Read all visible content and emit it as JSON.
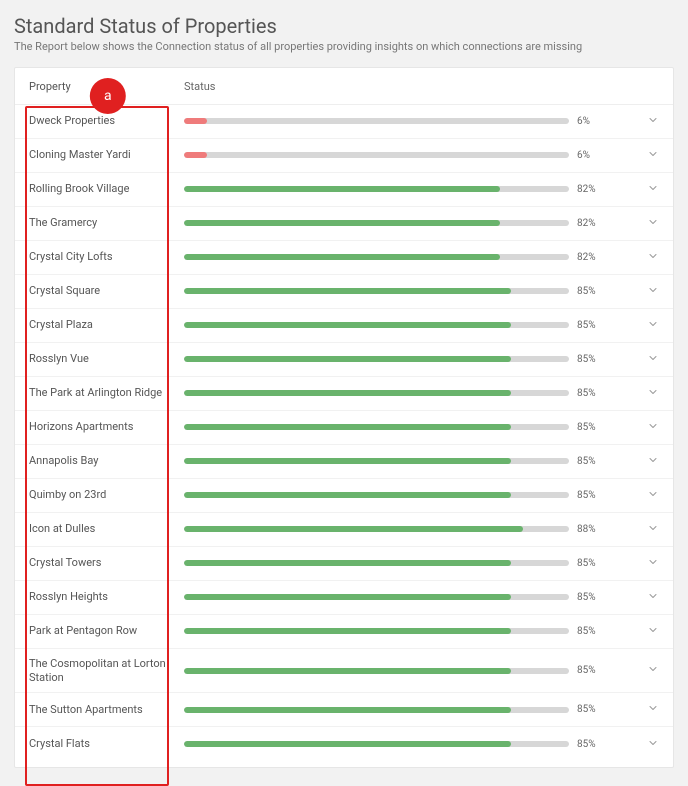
{
  "page": {
    "title": "Standard Status of Properties",
    "subtitle": "The Report below shows the Connection status of all properties providing insights on which connections are missing"
  },
  "table": {
    "headers": {
      "property": "Property",
      "status": "Status"
    }
  },
  "colors": {
    "low": "#ef7b7b",
    "ok": "#69b36c",
    "track": "#d7d7d7"
  },
  "rows": [
    {
      "name": "Dweck Properties",
      "pct": 6,
      "level": "low"
    },
    {
      "name": "Cloning Master Yardi",
      "pct": 6,
      "level": "low"
    },
    {
      "name": "Rolling Brook Village",
      "pct": 82,
      "level": "ok"
    },
    {
      "name": "The Gramercy",
      "pct": 82,
      "level": "ok"
    },
    {
      "name": "Crystal City Lofts",
      "pct": 82,
      "level": "ok"
    },
    {
      "name": "Crystal Square",
      "pct": 85,
      "level": "ok"
    },
    {
      "name": "Crystal Plaza",
      "pct": 85,
      "level": "ok"
    },
    {
      "name": "Rosslyn Vue",
      "pct": 85,
      "level": "ok"
    },
    {
      "name": "The Park at Arlington Ridge",
      "pct": 85,
      "level": "ok"
    },
    {
      "name": "Horizons Apartments",
      "pct": 85,
      "level": "ok"
    },
    {
      "name": "Annapolis Bay",
      "pct": 85,
      "level": "ok"
    },
    {
      "name": "Quimby on 23rd",
      "pct": 85,
      "level": "ok"
    },
    {
      "name": "Icon at Dulles",
      "pct": 88,
      "level": "ok"
    },
    {
      "name": "Crystal Towers",
      "pct": 85,
      "level": "ok"
    },
    {
      "name": "Rosslyn Heights",
      "pct": 85,
      "level": "ok"
    },
    {
      "name": "Park at Pentagon Row",
      "pct": 85,
      "level": "ok"
    },
    {
      "name": "The Cosmopolitan at Lorton Station",
      "pct": 85,
      "level": "ok"
    },
    {
      "name": "The Sutton Apartments",
      "pct": 85,
      "level": "ok"
    },
    {
      "name": "Crystal Flats",
      "pct": 85,
      "level": "ok"
    }
  ],
  "annotation": {
    "label": "a"
  },
  "chart_data": {
    "type": "bar",
    "title": "Standard Status of Properties",
    "xlabel": "Status (%)",
    "ylabel": "Property",
    "xlim": [
      0,
      100
    ],
    "categories": [
      "Dweck Properties",
      "Cloning Master Yardi",
      "Rolling Brook Village",
      "The Gramercy",
      "Crystal City Lofts",
      "Crystal Square",
      "Crystal Plaza",
      "Rosslyn Vue",
      "The Park at Arlington Ridge",
      "Horizons Apartments",
      "Annapolis Bay",
      "Quimby on 23rd",
      "Icon at Dulles",
      "Crystal Towers",
      "Rosslyn Heights",
      "Park at Pentagon Row",
      "The Cosmopolitan at Lorton Station",
      "The Sutton Apartments",
      "Crystal Flats"
    ],
    "values": [
      6,
      6,
      82,
      82,
      82,
      85,
      85,
      85,
      85,
      85,
      85,
      85,
      88,
      85,
      85,
      85,
      85,
      85,
      85
    ]
  }
}
